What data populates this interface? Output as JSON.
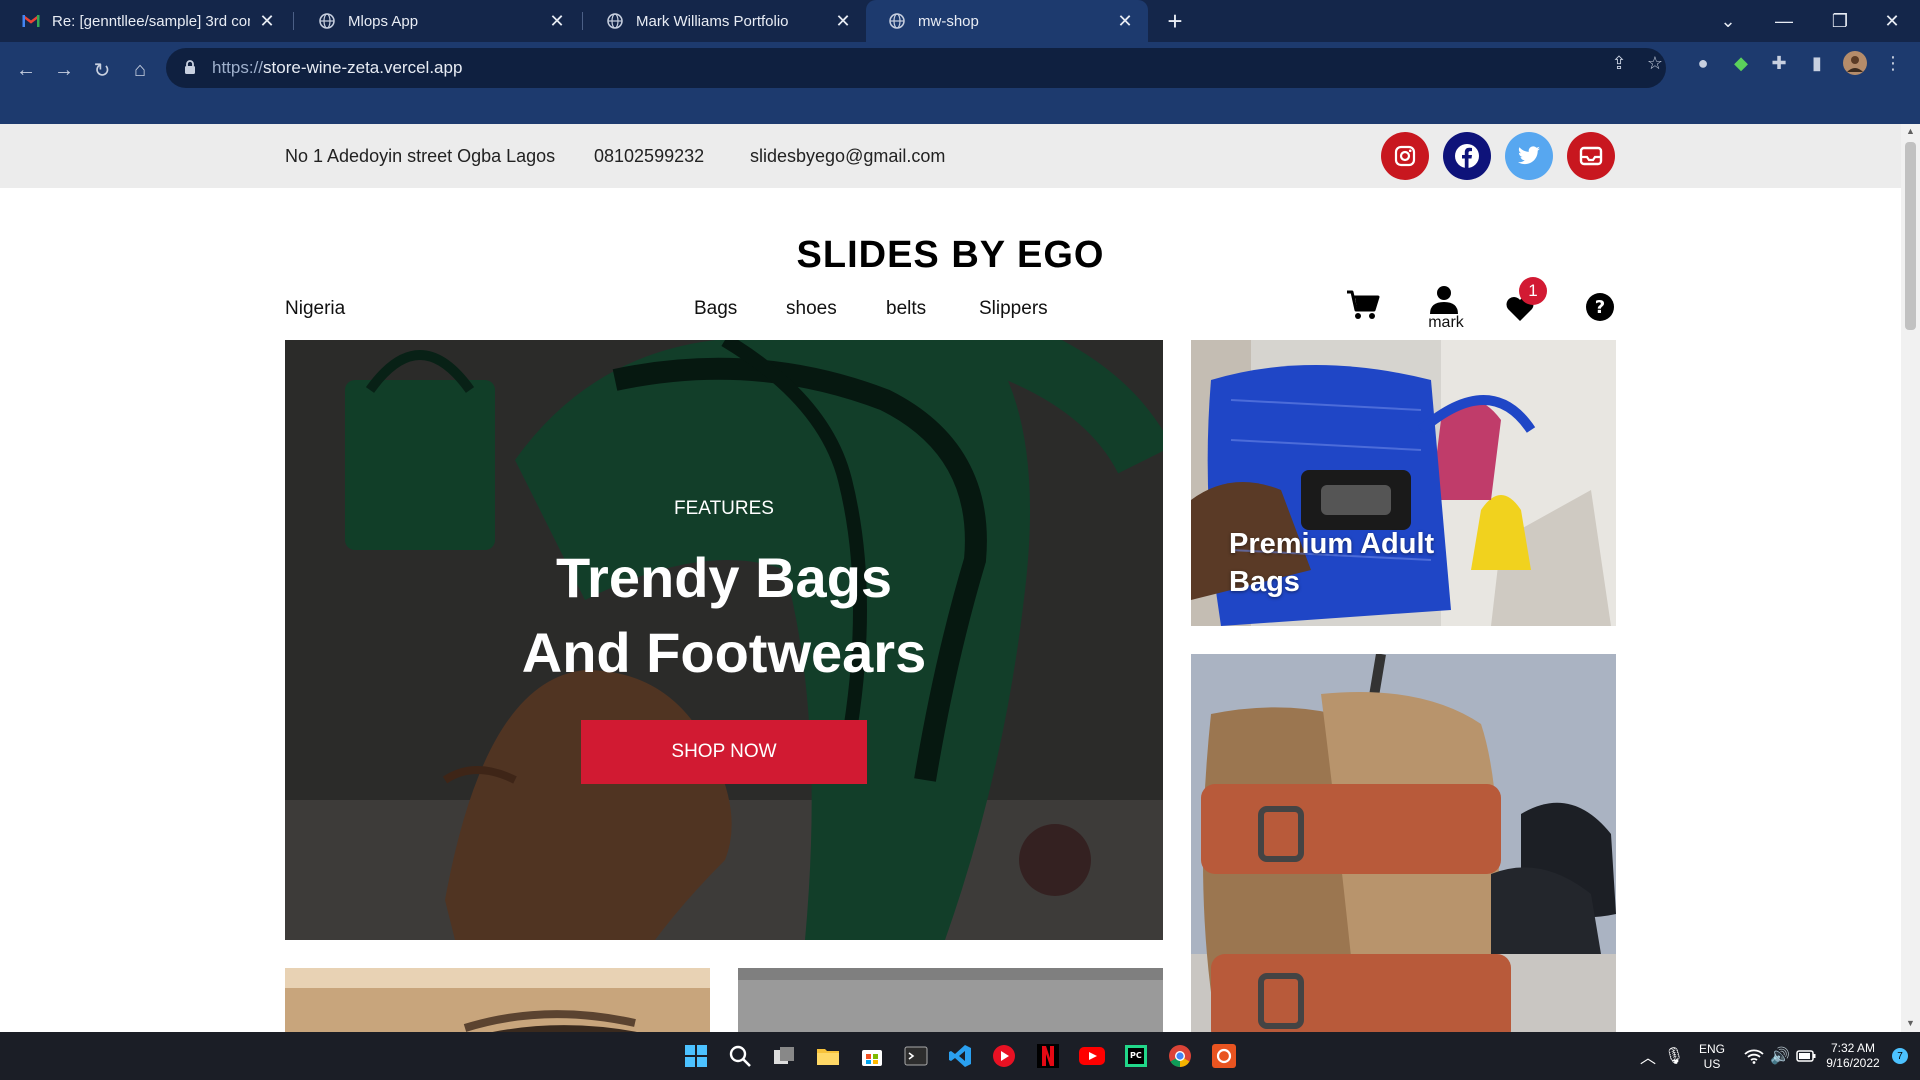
{
  "browser": {
    "tabs": [
      {
        "title": "Re: [genntllee/sample] 3rd comm",
        "icon": "gmail-icon"
      },
      {
        "title": "Mlops App",
        "icon": "globe-icon"
      },
      {
        "title": "Mark Williams Portfolio",
        "icon": "globe-icon"
      },
      {
        "title": "mw-shop",
        "icon": "globe-icon",
        "active": true
      }
    ],
    "new_tab": "+",
    "url_scheme": "https://",
    "url_host": "store-wine-zeta.vercel.app"
  },
  "topinfo": {
    "address": "No 1 Adedoyin street Ogba Lagos",
    "phone": "08102599232",
    "email": "slidesbyego@gmail.com",
    "socials": [
      {
        "name": "instagram",
        "color": "#c8171f"
      },
      {
        "name": "facebook",
        "color": "#0e137a"
      },
      {
        "name": "twitter",
        "color": "#57a7f0"
      },
      {
        "name": "email",
        "color": "#c8171f"
      }
    ]
  },
  "header": {
    "brand": "SLIDES BY EGO",
    "country": "Nigeria",
    "nav": [
      "Bags",
      "shoes",
      "belts",
      "Slippers"
    ],
    "user_label": "mark",
    "wishlist_count": "1"
  },
  "hero": {
    "kicker": "FEATURES",
    "title_line1": "Trendy Bags",
    "title_line2": "And Footwears",
    "cta": "SHOP NOW"
  },
  "cards": [
    {
      "label": "Premium Adult Bags"
    }
  ],
  "taskbar": {
    "lang_top": "ENG",
    "lang_bottom": "US",
    "time": "7:32 AM",
    "date": "9/16/2022",
    "notif_count": "7"
  },
  "colors": {
    "accent": "#d11a32",
    "chrome_dark": "#14264a",
    "chrome": "#1d3a6e"
  }
}
